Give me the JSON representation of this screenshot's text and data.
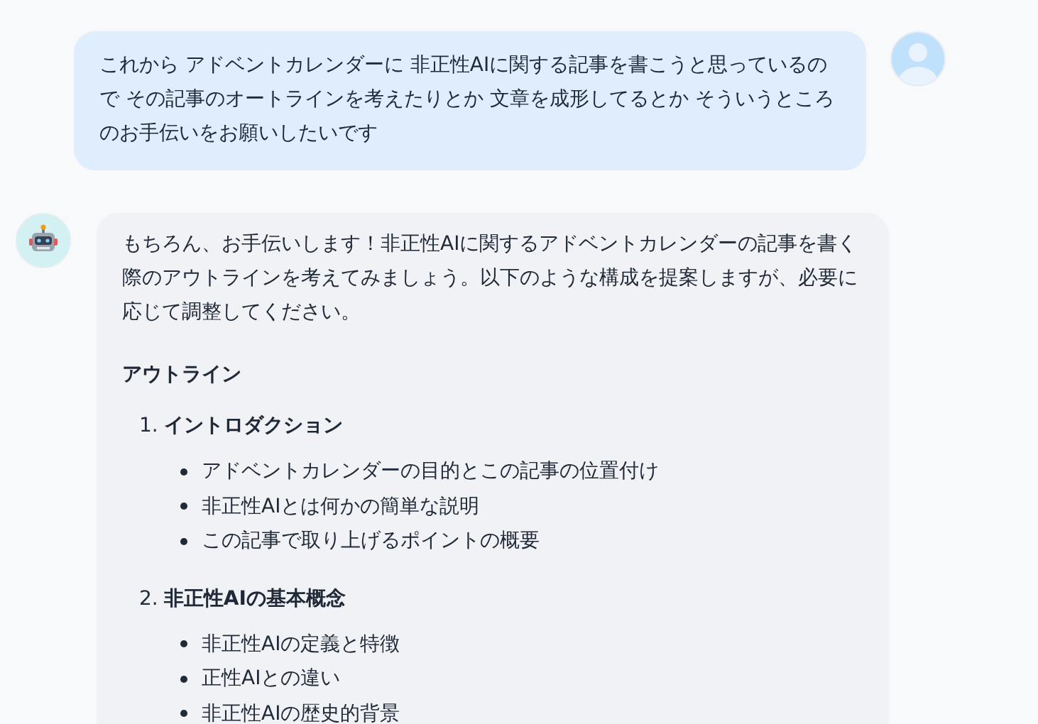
{
  "messages": [
    {
      "kind": "user",
      "text": "これから アドベントカレンダーに 非正性AIに関する記事を書こうと思っているので その記事のオートラインを考えたりとか 文章を成形してるとか そういうところのお手伝いをお願いしたいです"
    },
    {
      "kind": "assistant",
      "paragraphs": [
        "もちろん、お手伝いします！非正性AIに関するアドベントカレンダーの記事を書く際のアウトラインを考えてみましょう。以下のような構成を提案しますが、必要に応じて調整してください。"
      ],
      "heading": "アウトライン",
      "sections": [
        {
          "number": "1.",
          "title": "イントロダクション",
          "bullets": [
            "アドベントカレンダーの目的とこの記事の位置付け",
            "非正性AIとは何かの簡単な説明",
            "この記事で取り上げるポイントの概要"
          ]
        },
        {
          "number": "2.",
          "title": "非正性AIの基本概念",
          "bullets": [
            "非正性AIの定義と特徴",
            "正性AIとの違い",
            "非正性AIの歴史的背景"
          ]
        }
      ]
    }
  ]
}
